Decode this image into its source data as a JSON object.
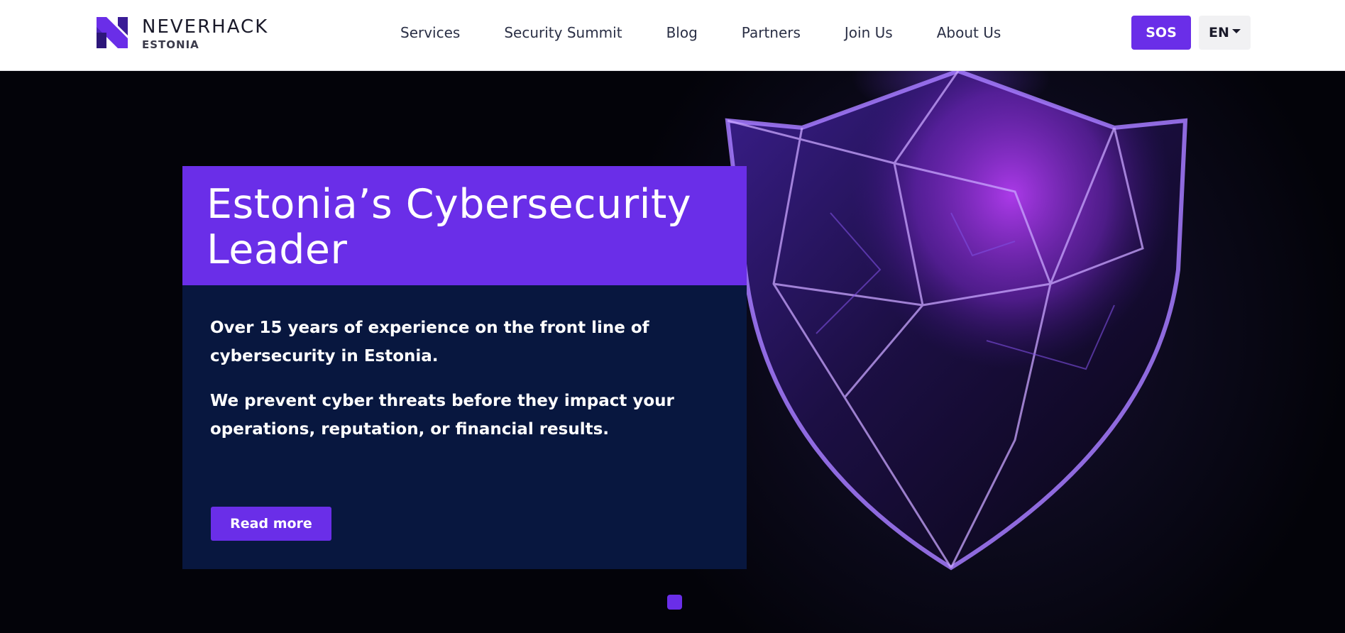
{
  "header": {
    "brand": "NEVERHACK",
    "brand_sub": "ESTONIA",
    "nav": [
      {
        "label": "Services"
      },
      {
        "label": "Security Summit"
      },
      {
        "label": "Blog"
      },
      {
        "label": "Partners"
      },
      {
        "label": "Join Us"
      },
      {
        "label": "About Us"
      }
    ],
    "sos_label": "SOS",
    "language": "EN"
  },
  "hero": {
    "title": "Estonia’s Cybersecurity Leader",
    "paragraphs": [
      "Over 15 years of experience on the front line of cybersecurity in Estonia.",
      "We prevent cyber threats before they impact your operations, reputation, or financial results."
    ],
    "cta_label": "Read more",
    "slide_count": 1,
    "active_slide": 1
  },
  "colors": {
    "accent": "#6a2ee8",
    "panel": "#08173f",
    "header_bg": "#ffffff",
    "nav_text": "#2a2f45"
  },
  "icons": {
    "logo": "neverhack-n-logo-icon",
    "language_caret": "caret-down-icon",
    "hero_image": "crystal-shield-icon"
  }
}
